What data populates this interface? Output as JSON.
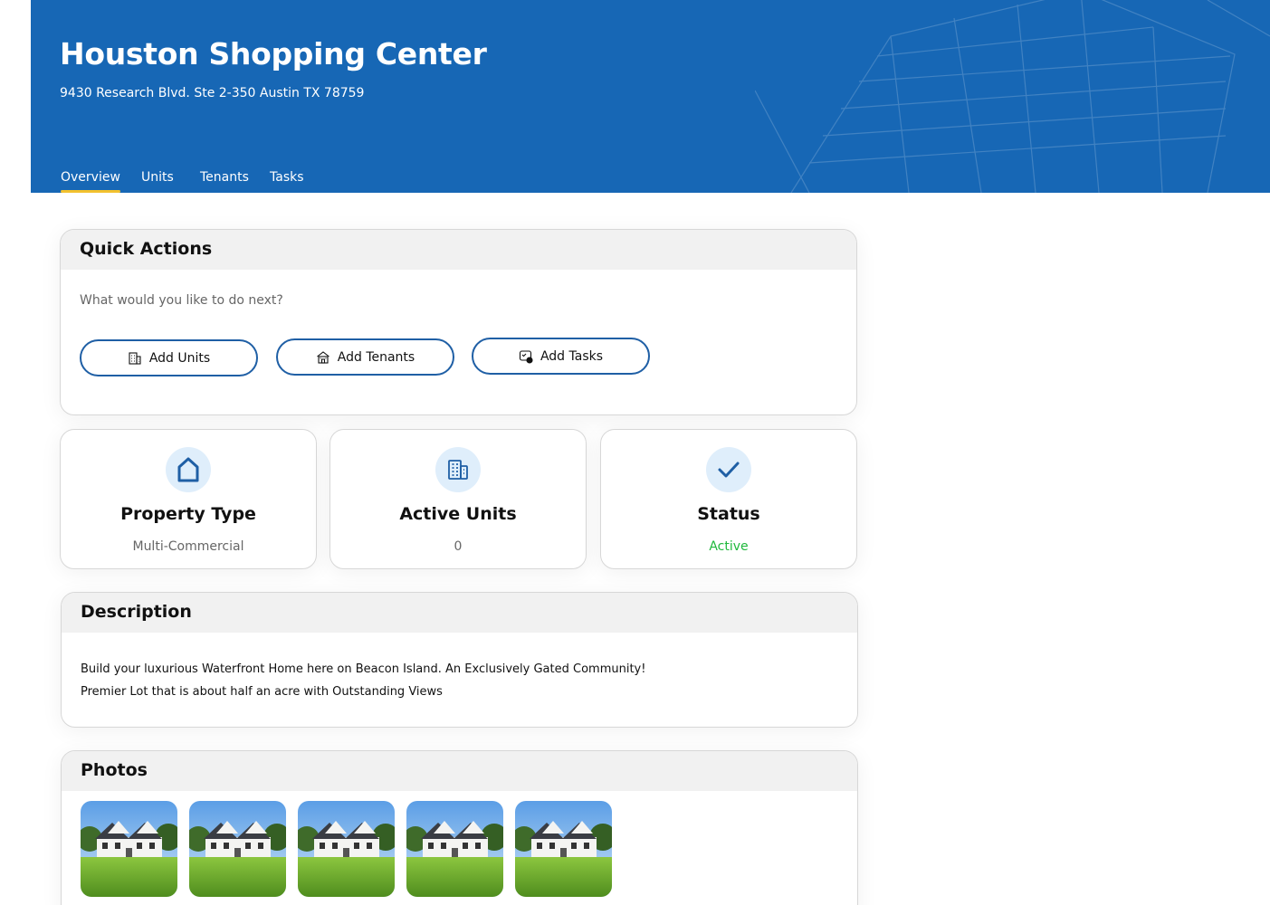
{
  "header": {
    "title": "Houston Shopping Center",
    "address": "9430 Research Blvd. Ste 2-350 Austin TX 78759",
    "background_color": "#1767b5",
    "active_tab_indicator_color": "#f2c12e",
    "tabs": [
      {
        "label": "Overview",
        "active": true
      },
      {
        "label": "Units",
        "active": false
      },
      {
        "label": "Tenants",
        "active": false
      },
      {
        "label": "Tasks",
        "active": false
      }
    ]
  },
  "quick_actions": {
    "title": "Quick Actions",
    "subtitle": "What would you like to do next?",
    "buttons": [
      {
        "label": "Add Units",
        "icon": "building-icon"
      },
      {
        "label": "Add Tenants",
        "icon": "tenants-icon"
      },
      {
        "label": "Add Tasks",
        "icon": "tasks-icon"
      }
    ]
  },
  "stats": [
    {
      "title": "Property Type",
      "value": "Multi-Commercial",
      "icon": "home-icon"
    },
    {
      "title": "Active Units",
      "value": "0",
      "icon": "building-icon"
    },
    {
      "title": "Status",
      "value": "Active",
      "icon": "check-icon",
      "value_color": "#1fb83c"
    }
  ],
  "description": {
    "title": "Description",
    "lines": [
      "Build your luxurious Waterfront Home here on Beacon Island. An Exclusively Gated Community!",
      "Premier Lot that is about half an acre with Outstanding Views"
    ]
  },
  "photos": {
    "title": "Photos",
    "count": 5
  },
  "colors": {
    "accent": "#1f5fa5",
    "icon_bg": "#dfeefb",
    "active_status": "#1fb83c"
  }
}
